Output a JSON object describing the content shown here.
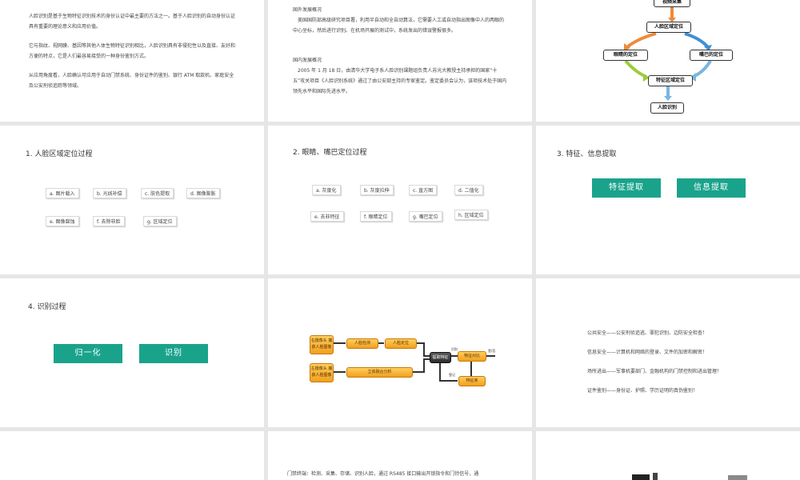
{
  "slide1": {
    "para1": "人脸识别是基于生物特征识别技术的身份认证中最主要的方法之一。基于人脸识别的自动身份认证具有重要的理论意义和应用价值。",
    "para2": "它与指纹、视网膜、基因等其他人体生物特征识别相比，人脸识别具有非侵犯性以及直接、友好和方便的特点，它是人们最容易接受的一种身份鉴别方式。",
    "para3": "从应用角度看，人脸确认可应用于自动门禁系统、身份证件的鉴别、银行 ATM 取款机、家庭安全及公安刑侦追踪等领域。"
  },
  "slide2": {
    "foreign_title": "国外发展概况",
    "foreign_text": "美国国防部高级研究项目署，利用半自动和全自动算法，它需要人工或自动指出图像中人的两眼的中心坐标，然后进行识别。在机场开展的测试中，系统发出的错误警报很多。",
    "domestic_title": "国内发展概况",
    "domestic_text": "2005 年 1 月 18 日，由清华大学电子系人脸识别课题组负责人苏光大教授主持承担的国家“十五”攻关项目《人脸识别系统》通过了由公安部主持的专家鉴定。鉴定委员会认为，该项技术处于国内领先水平和国际先进水平。"
  },
  "slide3": {
    "video": "视频采集",
    "face_region": "人脸区域定位",
    "eyes": "眼睛的定位",
    "mouth": "嘴巴的定位",
    "feature_region": "特征区域定位",
    "recognition": "人脸识别"
  },
  "slide4": {
    "title": "1. 人脸区域定位过程",
    "tags": [
      "a. 图片载入",
      "b. 光线补偿",
      "c. 肤色提取",
      "d. 图像膨胀",
      "e. 图像腐蚀",
      "f. 去除非脸",
      "g. 区域定位"
    ]
  },
  "slide5": {
    "title": "2. 眼睛、嘴巴定位过程",
    "tags": [
      "a. 灰度化",
      "b. 灰度拉伸",
      "c. 直方图",
      "d. 二值化",
      "e. 去非特征",
      "f. 眼睛定位",
      "g. 嘴巴定位",
      "h. 区域定位"
    ]
  },
  "slide6": {
    "title": "3. 特征、信息提取",
    "btn1": "特征提取",
    "btn2": "信息提取"
  },
  "slide7": {
    "title": "4. 识别过程",
    "btn1": "归一化",
    "btn2": "识别"
  },
  "slide8": {
    "cam1": "右摄像头 捕获人脸图像",
    "cam2": "左摄像头 捕获人脸图像",
    "detect": "人脸检测",
    "locate": "人脸定位",
    "fusion": "立体融合分析",
    "extract": "提取特征",
    "compare": "特征对比",
    "library": "特征库",
    "label_recognize": "识别",
    "label_register": "登记",
    "label_yesno": "是/否"
  },
  "slide9": {
    "lines": [
      "公共安全——公安刑侦追逃、罪犯识别、边防安全检查！",
      "信息安全——计算机和网络的登录、文件的加密和解密！",
      "场所进出——军事机要部门、金融机构的门禁控制和进出管理！",
      "证件鉴别——身份证、护照、学历证明的真伪鉴别！"
    ]
  },
  "slide11": {
    "text": "门禁终端：检测、采集、存储、识别人脸，通过 RS485 接口输出开锁指令和门铃信号，通"
  }
}
